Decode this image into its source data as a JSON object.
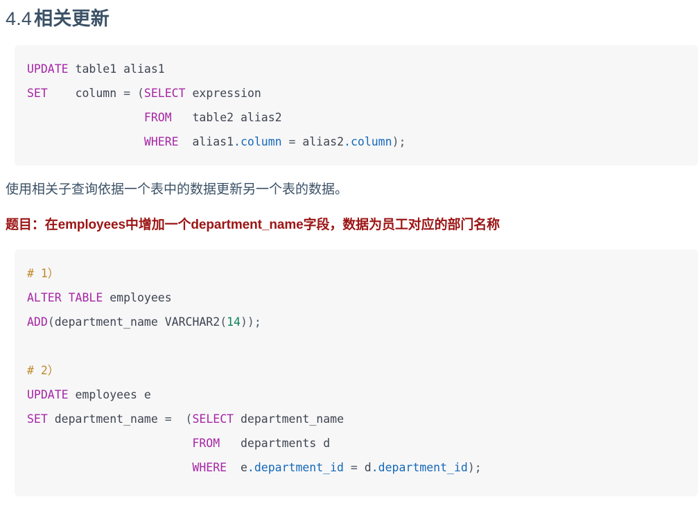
{
  "document": {
    "heading": {
      "number": "4.4",
      "title": "相关更新"
    },
    "paragraph": "使用相关子查询依据一个表中的数据更新另一个表的数据。",
    "task_note": "题目：在employees中增加一个department_name字段，数据为员工对应的部门名称",
    "code_block_1": {
      "language": "sql",
      "lines": [
        "UPDATE table1 alias1",
        "SET    column = (SELECT expression",
        "                 FROM   table2 alias2",
        "                 WHERE  alias1.column = alias2.column);"
      ],
      "tokens": {
        "keywords": [
          "UPDATE",
          "SET",
          "SELECT",
          "FROM",
          "WHERE"
        ],
        "identifiers": [
          "table1",
          "alias1",
          "column",
          "expression",
          "table2",
          "alias2"
        ],
        "properties": [
          ".column"
        ]
      }
    },
    "code_block_2": {
      "language": "sql",
      "lines": [
        "# 1）",
        "ALTER TABLE employees",
        "ADD(department_name VARCHAR2(14));",
        "",
        "# 2）",
        "UPDATE employees e",
        "SET department_name =  (SELECT department_name",
        "                        FROM   departments d",
        "                        WHERE  e.department_id = d.department_id);"
      ],
      "comments": [
        "# 1）",
        "# 2）"
      ],
      "tokens": {
        "keywords": [
          "ALTER",
          "TABLE",
          "ADD",
          "UPDATE",
          "SET",
          "SELECT",
          "FROM",
          "WHERE"
        ],
        "identifiers": [
          "employees",
          "department_name",
          "VARCHAR2",
          "e",
          "departments",
          "d"
        ],
        "numbers": [
          "14"
        ],
        "properties": [
          ".department_id"
        ]
      }
    }
  },
  "colors": {
    "heading": "#3b5166",
    "body_text": "#3b5166",
    "emphasis_red": "#9b1414",
    "code_background": "#f7f7f8",
    "keyword": "#a626a4",
    "identifier": "#3e4450",
    "property": "#1468b8",
    "number": "#0b8257",
    "comment": "#bf8a2a",
    "page_background": "#ffffff"
  }
}
